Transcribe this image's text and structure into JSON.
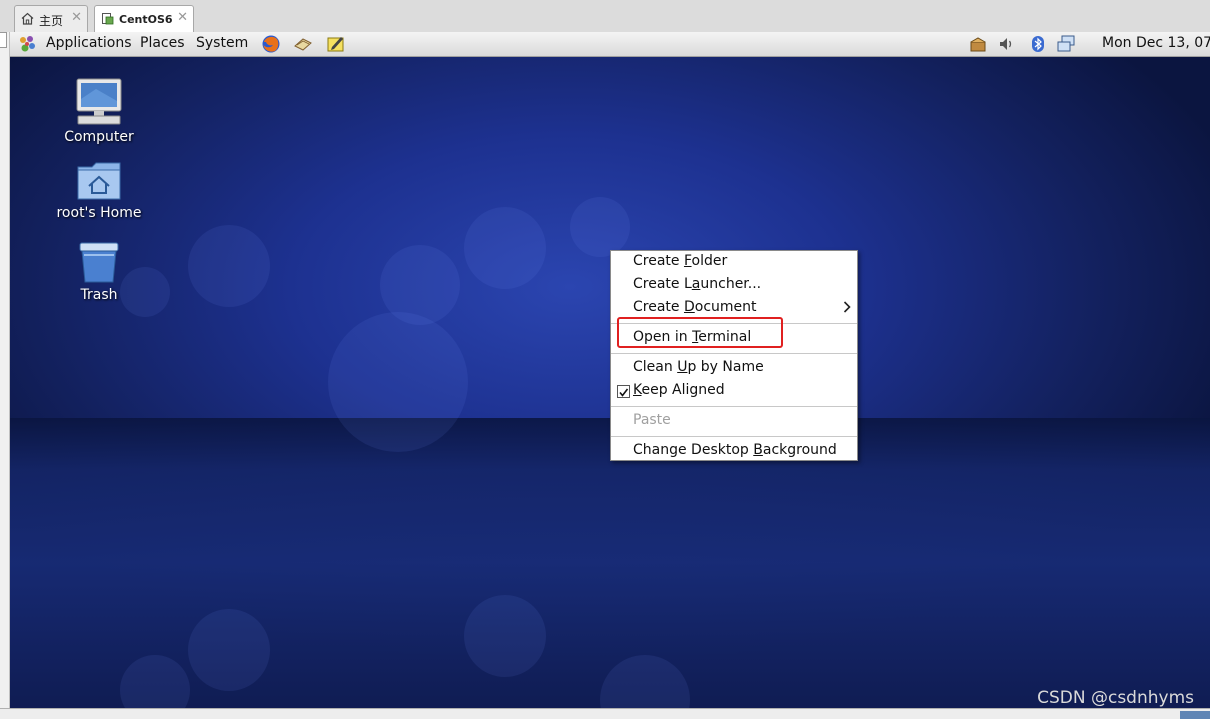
{
  "tabs": [
    {
      "label": "主页",
      "icon": "home-icon",
      "active": false
    },
    {
      "label": "CentOS6",
      "icon": "vm-icon",
      "active": true
    }
  ],
  "panel": {
    "menus": [
      "Applications",
      "Places",
      "System"
    ],
    "launchers": [
      "firefox-icon",
      "mail-icon",
      "notes-icon"
    ],
    "tray": [
      "updates-icon",
      "volume-icon",
      "bluetooth-icon",
      "network-icon"
    ],
    "clock": "Mon Dec 13, 07"
  },
  "desktop_icons": [
    {
      "label": "Computer",
      "icon": "computer-icon"
    },
    {
      "label": "root's Home",
      "icon": "home-folder-icon"
    },
    {
      "label": "Trash",
      "icon": "trash-icon"
    }
  ],
  "context_menu": {
    "create_folder": {
      "pre": "Create ",
      "mn": "F",
      "post": "older"
    },
    "create_launcher": {
      "pre": "Create L",
      "mn": "a",
      "post": "uncher..."
    },
    "create_document": {
      "pre": "Create ",
      "mn": "D",
      "post": "ocument"
    },
    "open_terminal": {
      "pre": "Open in ",
      "mn": "T",
      "post": "erminal"
    },
    "clean_up": {
      "pre": "Clean ",
      "mn": "U",
      "post": "p by Name"
    },
    "keep_aligned": {
      "pre": "",
      "mn": "K",
      "post": "eep Aligned",
      "checked": true
    },
    "paste": {
      "pre": "Paste",
      "mn": "",
      "post": "",
      "disabled": true
    },
    "change_background": {
      "pre": "Change Desktop ",
      "mn": "B",
      "post": "ackground"
    }
  },
  "watermark": "CSDN @csdnhyms",
  "colors": {
    "highlight": "#e02020",
    "desktop": "#1d3190"
  }
}
